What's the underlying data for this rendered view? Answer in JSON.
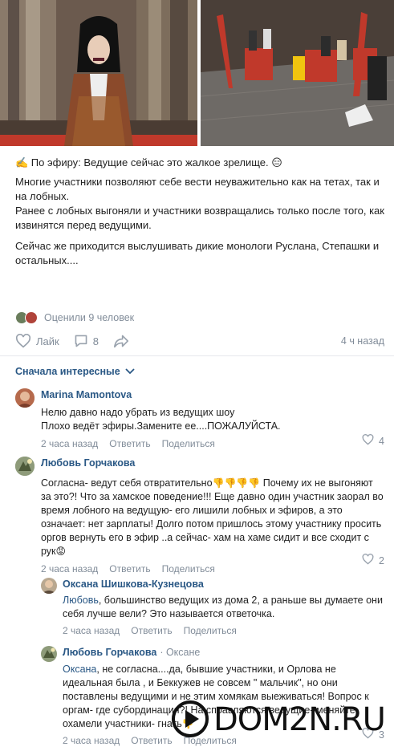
{
  "post": {
    "paragraph1": "✍️ По эфиру: Ведущие сейчас это жалкое зрелище. 😑",
    "paragraph2": "Многие участники позволяют себе вести неуважительно как на тетах, так и на лобных.",
    "paragraph3": "Ранее с лобных выгоняли и участники возвращались только после того, как извинятся перед ведущими.",
    "paragraph4": "Сейчас же приходится выслушивать дикие монологи Руслана, Степашки и остальных...."
  },
  "reactions": {
    "rated_text": "Оценили 9 человек"
  },
  "actions": {
    "like_label": "Лайк",
    "comments_count": "8",
    "time": "4 ч назад"
  },
  "sort": {
    "label": "Сначала интересные"
  },
  "comments": [
    {
      "author": "Marina Mamontova",
      "text": "Нелю давно надо убрать из ведущих шоу\nПлохо ведёт эфиры.Замените ее....ПОЖАЛУЙСТА.",
      "time": "2 часа назад",
      "reply_label": "Ответить",
      "share_label": "Поделиться",
      "likes": "4"
    },
    {
      "author": "Любовь Горчакова",
      "text_before": "Согласна- ведут себя отвратительно",
      "emoji1": "👎👎👎👎",
      "text_after": " Почему их не выгоняют за это?! Что за хамское поведение!!! Еще давно один участник заорал во время лобного на ведущую- его лишили лобных и эфиров, а это означает: нет зарплаты! Долго потом пришлось этому участнику просить оргов вернуть его в эфир ..а сейчас- хам на хаме сидит и все сходит с рук",
      "emoji2": "😡",
      "time": "2 часа назад",
      "reply_label": "Ответить",
      "share_label": "Поделиться",
      "likes": "2"
    },
    {
      "author": "Оксана Шишкова-Кузнецова",
      "address": "Любовь",
      "text": ", большинство ведущих из дома 2, а раньше вы думаете они себя лучше вели? Это называется ответочка.",
      "time": "2 часа назад",
      "reply_label": "Ответить",
      "share_label": "Поделиться"
    },
    {
      "author": "Любовь Горчакова",
      "reply_to": "· Оксане",
      "address": "Оксана",
      "text": ", не согласна....да, бывшие участники, и Орлова не идеальная была , и Беккужев не совсем \" мальчик\", но они поставлены ведущими и не этим хомякам выеживаться! Вопрос к оргам- где субординация?! На справляются ведущие- меняйте. охамели участники- гнать",
      "emoji": "👎",
      "time": "2 часа назад",
      "reply_label": "Ответить",
      "share_label": "Поделиться",
      "likes": "3"
    }
  ],
  "watermark": {
    "text": "DOM2N.RU"
  },
  "colors": {
    "link": "#2a5885",
    "muted": "#818c99",
    "divider": "#e7e8ec",
    "watermark_accent": "#111111"
  }
}
